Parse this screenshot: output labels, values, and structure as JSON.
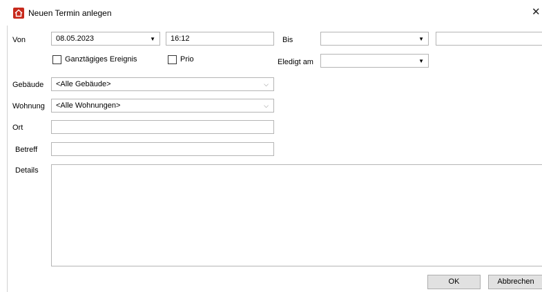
{
  "window": {
    "title": "Neuen Termin anlegen",
    "close_glyph": "✕"
  },
  "von": {
    "label": "Von",
    "date": "08.05.2023",
    "time": "16:12"
  },
  "bis": {
    "label": "Bis",
    "date": "",
    "time": ""
  },
  "options": {
    "ganztaegig_label": "Ganztägiges Ereignis",
    "prio_label": "Prio",
    "ganztaegig_checked": false,
    "prio_checked": false
  },
  "erledigt": {
    "label": "Eledigt am",
    "date": ""
  },
  "gebaeude": {
    "label": "Gebäude",
    "value": "<Alle Gebäude>"
  },
  "wohnung": {
    "label": "Wohnung",
    "value": "<Alle Wohnungen>"
  },
  "ort": {
    "label": "Ort",
    "value": ""
  },
  "betreff": {
    "label": "Betreff",
    "value": ""
  },
  "details": {
    "label": "Details",
    "value": ""
  },
  "buttons": {
    "ok": "OK",
    "cancel": "Abbrechen"
  },
  "icons": {
    "app": "home-icon",
    "dropdown": "dropdown-arrow-icon",
    "chevron": "chevron-down-icon"
  },
  "colors": {
    "app_icon": "#c72a1c",
    "button_bg": "#e1e1e1"
  }
}
